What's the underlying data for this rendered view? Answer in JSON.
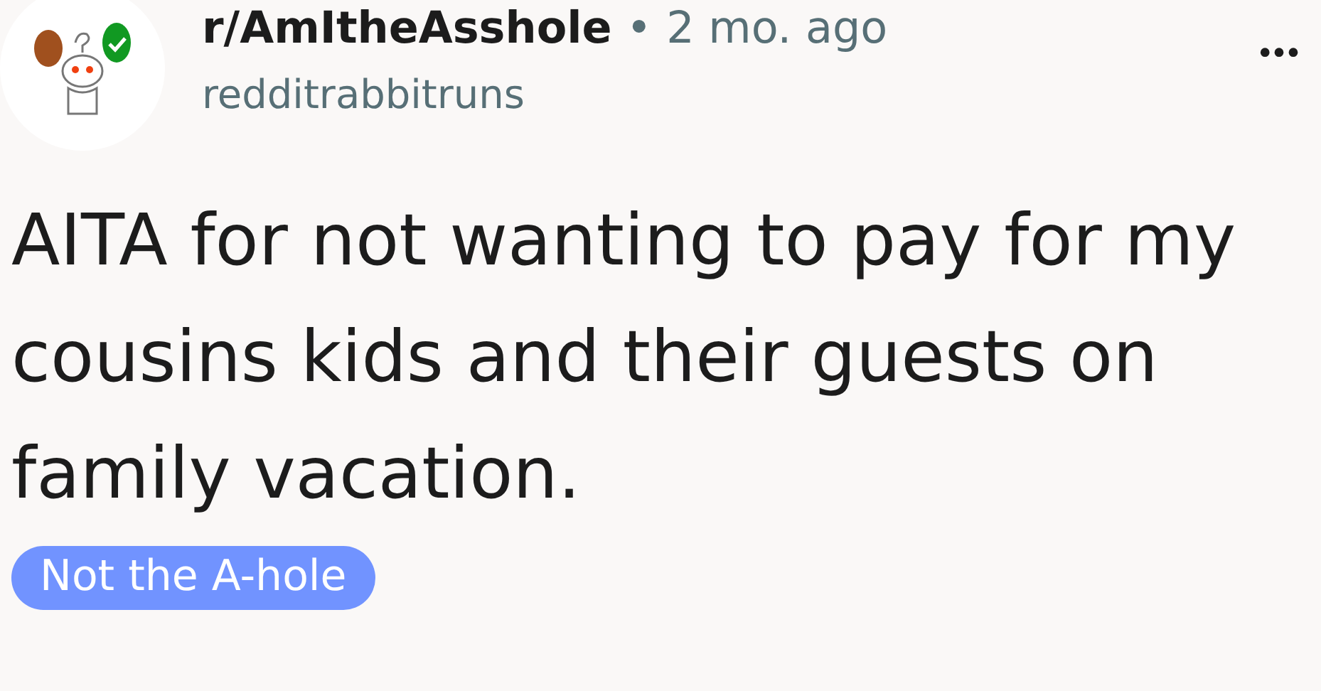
{
  "post": {
    "subreddit": "r/AmItheAsshole",
    "separator": "•",
    "time": "2 mo. ago",
    "author": "redditrabbitruns",
    "more": "•••",
    "title": "AITA for not wanting to pay for my cousins kids and their guests on family vacation.",
    "flair": {
      "label": "Not the A-hole",
      "color": "#7193ff"
    }
  }
}
